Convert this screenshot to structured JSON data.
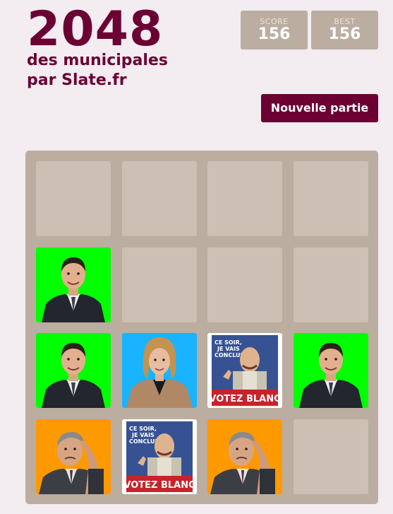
{
  "header": {
    "title": "2048",
    "subtitle_line1": "des municipales",
    "subtitle_line2": "par Slate.fr"
  },
  "scores": {
    "score_label": "SCORE",
    "score_value": "156",
    "best_label": "BEST",
    "best_value": "156"
  },
  "new_game_label": "Nouvelle partie",
  "tiles": [
    {
      "row": 1,
      "col": 0,
      "kind": "man-dark-suit",
      "bg": "#00ff00"
    },
    {
      "row": 2,
      "col": 0,
      "kind": "man-dark-suit",
      "bg": "#00ff00"
    },
    {
      "row": 2,
      "col": 1,
      "kind": "woman-blonde",
      "bg": "#1ab3ff"
    },
    {
      "row": 2,
      "col": 2,
      "kind": "votez-blanc-poster",
      "bg": "#ffffff",
      "poster_top": "CE SOIR, JE VAIS CONCLURE",
      "poster_bottom": "VOTEZ BLANC"
    },
    {
      "row": 2,
      "col": 3,
      "kind": "man-dark-suit",
      "bg": "#00ff00"
    },
    {
      "row": 3,
      "col": 0,
      "kind": "man-thinking",
      "bg": "#ff9900"
    },
    {
      "row": 3,
      "col": 1,
      "kind": "votez-blanc-poster",
      "bg": "#ffffff",
      "poster_top": "CE SOIR, JE VAIS CONCLURE",
      "poster_bottom": "VOTEZ BLANC"
    },
    {
      "row": 3,
      "col": 2,
      "kind": "man-thinking",
      "bg": "#ff9900"
    }
  ]
}
